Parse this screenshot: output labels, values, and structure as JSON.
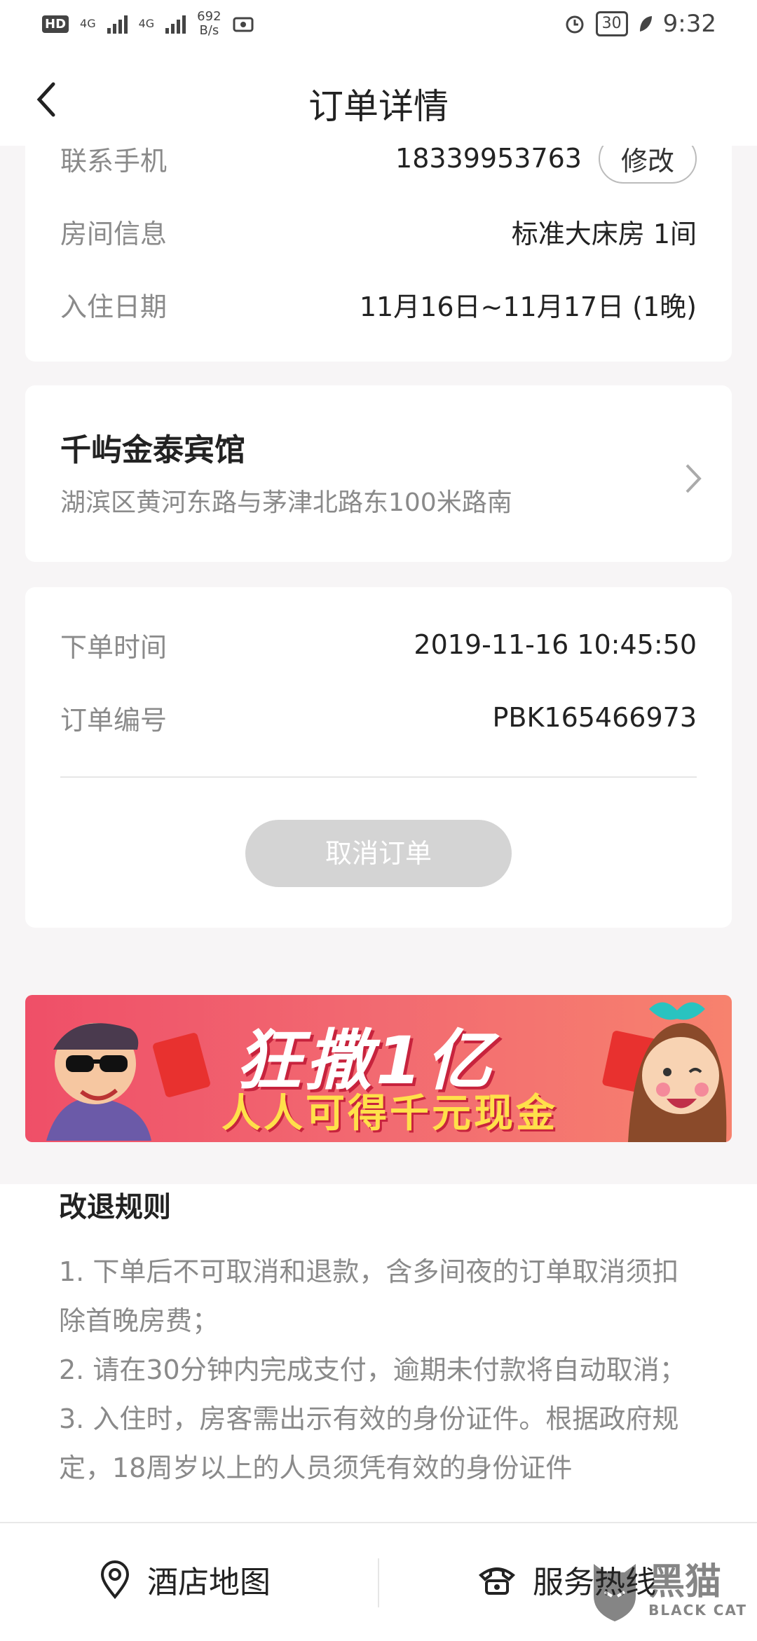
{
  "status_bar": {
    "hd": "HD",
    "net_speed": "692",
    "net_unit": "B/s",
    "signal1": "4G",
    "signal2": "4G",
    "battery": "30",
    "time": "9:32"
  },
  "header": {
    "title": "订单详情"
  },
  "guest_info": {
    "phone_label": "联系手机",
    "phone_value": "18339953763",
    "edit_label": "修改",
    "room_label": "房间信息",
    "room_value": "标准大床房 1间",
    "date_label": "入住日期",
    "date_value": "11月16日~11月17日 (1晚)"
  },
  "hotel": {
    "name": "千屿金泰宾馆",
    "address": "湖滨区黄河东路与茅津北路东100米路南"
  },
  "order": {
    "time_label": "下单时间",
    "time_value": "2019-11-16 10:45:50",
    "number_label": "订单编号",
    "number_value": "PBK165466973",
    "cancel_label": "取消订单"
  },
  "banner": {
    "line1": "狂撒1亿",
    "line2": "人人可得千元现金"
  },
  "rules": {
    "title": "改退规则",
    "items": [
      "1. 下单后不可取消和退款，含多间夜的订单取消须扣除首晚房费；",
      "2. 请在30分钟内完成支付，逾期未付款将自动取消；",
      "3. 入住时，房客需出示有效的身份证件。根据政府规定，18周岁以上的人员须凭有效的身份证件"
    ]
  },
  "bottom_bar": {
    "map_label": "酒店地图",
    "hotline_label": "服务热线"
  },
  "watermark": {
    "text": "黑猫",
    "sub": "BLACK CAT"
  }
}
